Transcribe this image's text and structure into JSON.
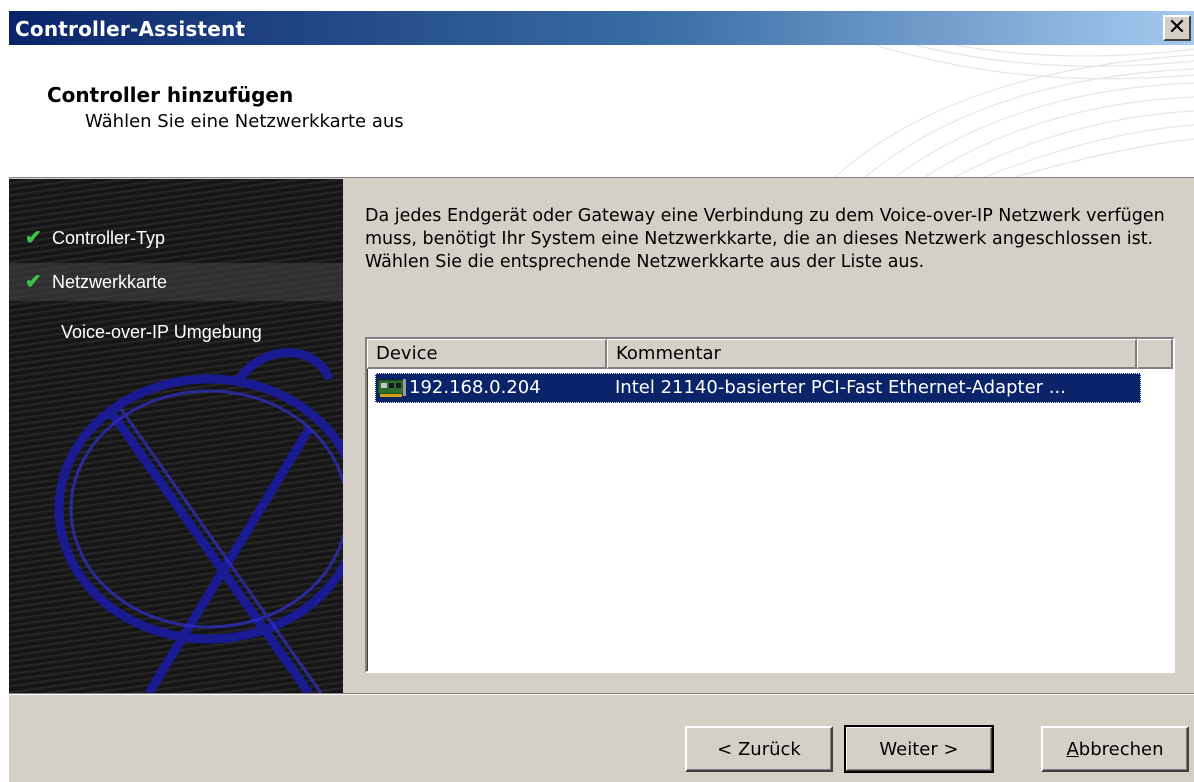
{
  "window": {
    "title": "Controller-Assistent",
    "close_symbol": "✕"
  },
  "header": {
    "title": "Controller hinzufügen",
    "subtitle": "Wählen Sie eine Netzwerkkarte aus"
  },
  "sidebar": {
    "steps": [
      {
        "label": "Controller-Typ",
        "checked": true,
        "active": false
      },
      {
        "label": "Netzwerkkarte",
        "checked": true,
        "active": true
      },
      {
        "label": "Voice-over-IP Umgebung",
        "checked": false,
        "active": false
      }
    ],
    "check_symbol": "✔",
    "check_color": "#3ec24a"
  },
  "main": {
    "description": "Da jedes Endgerät oder Gateway eine Verbindung zu dem Voice-over-IP Netzwerk verfügen muss, benötigt Ihr System eine Netzwerkkarte, die an dieses Netzwerk angeschlossen ist. Wählen Sie die entsprechende Netzwerkkarte aus der Liste aus.",
    "list": {
      "columns": [
        "Device",
        "Kommentar"
      ],
      "rows": [
        {
          "device": "192.168.0.204",
          "comment": "Intel 21140-basierter PCI-Fast Ethernet-Adapter ...",
          "icon": "network-card-icon",
          "selected": true
        }
      ]
    }
  },
  "footer": {
    "back_label": "< Zurück",
    "next_label": "Weiter >",
    "cancel_prefix": "",
    "cancel_mnemonic": "A",
    "cancel_rest": "bbrechen"
  },
  "colors": {
    "title_start": "#0a246a",
    "title_end": "#a6caf0",
    "selection": "#0a246a",
    "face": "#d4d0c8"
  }
}
